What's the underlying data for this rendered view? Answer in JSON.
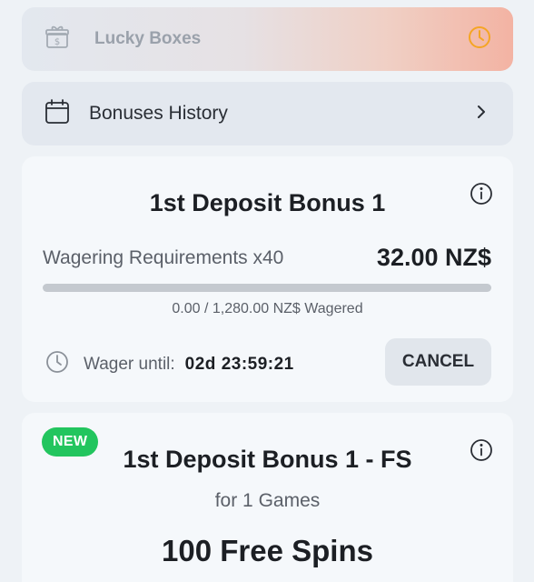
{
  "lucky_boxes": {
    "label": "Lucky Boxes",
    "icon": "gift-icon",
    "status_icon": "clock-icon"
  },
  "bonuses_history": {
    "label": "Bonuses History",
    "icon": "calendar-icon",
    "arrow_icon": "chevron-right-icon"
  },
  "bonus_card": {
    "title": "1st Deposit Bonus 1",
    "wager_label": "Wagering Requirements x40",
    "amount": "32.00 NZ$",
    "progress_fraction": 0.0,
    "wagered_text": "0.00 / 1,280.00 NZ$ Wagered",
    "wager_until_label": "Wager until:",
    "timer": "02d 23:59:21",
    "cancel_label": "CANCEL"
  },
  "fs_card": {
    "badge": "NEW",
    "title": "1st Deposit Bonus 1 - FS",
    "subtitle": "for 1 Games",
    "spins": "100 Free Spins"
  },
  "colors": {
    "badge_green": "#22c55e",
    "clock_orange": "#f5a524",
    "card_bg": "#f5f8fb"
  }
}
